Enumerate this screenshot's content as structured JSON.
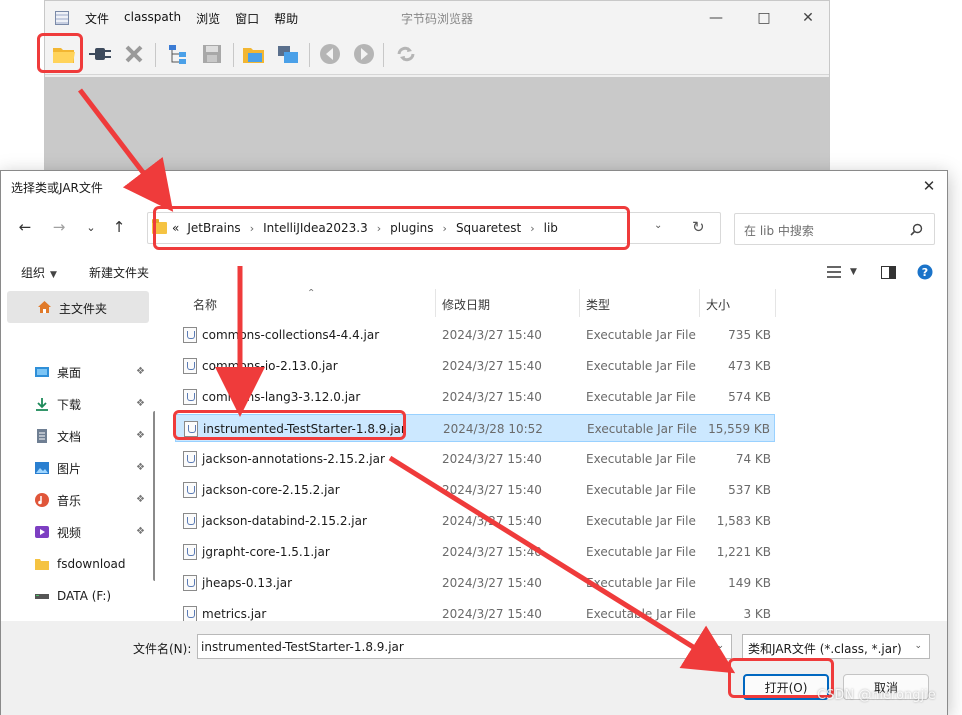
{
  "bg_app": {
    "menu": [
      "文件",
      "classpath",
      "浏览",
      "窗口",
      "帮助"
    ],
    "title": "字节码浏览器"
  },
  "dialog": {
    "title": "选择类或JAR文件",
    "breadcrumb_prefix": "«",
    "breadcrumb": [
      "JetBrains",
      "IntelliJIdea2023.3",
      "plugins",
      "Squaretest",
      "lib"
    ],
    "search_placeholder": "在 lib 中搜索",
    "commands": {
      "organize": "组织",
      "new_folder": "新建文件夹"
    },
    "sidebar": {
      "home": "主文件夹",
      "items": [
        {
          "label": "桌面",
          "icon": "desktop-icon",
          "pinned": true
        },
        {
          "label": "下载",
          "icon": "download-icon",
          "pinned": true
        },
        {
          "label": "文档",
          "icon": "document-icon",
          "pinned": true
        },
        {
          "label": "图片",
          "icon": "picture-icon",
          "pinned": true
        },
        {
          "label": "音乐",
          "icon": "music-icon",
          "pinned": true
        },
        {
          "label": "视频",
          "icon": "video-icon",
          "pinned": true
        },
        {
          "label": "fsdownload",
          "icon": "folder-icon",
          "pinned": false
        },
        {
          "label": "DATA (F:)",
          "icon": "drive-icon",
          "pinned": false
        }
      ]
    },
    "columns": {
      "name": "名称",
      "date": "修改日期",
      "type": "类型",
      "size": "大小"
    },
    "files": [
      {
        "name": "commons-collections4-4.4.jar",
        "date": "2024/3/27 15:40",
        "type": "Executable Jar File",
        "size": "735 KB"
      },
      {
        "name": "commons-io-2.13.0.jar",
        "date": "2024/3/27 15:40",
        "type": "Executable Jar File",
        "size": "473 KB"
      },
      {
        "name": "commons-lang3-3.12.0.jar",
        "date": "2024/3/27 15:40",
        "type": "Executable Jar File",
        "size": "574 KB"
      },
      {
        "name": "instrumented-TestStarter-1.8.9.jar",
        "date": "2024/3/28 10:52",
        "type": "Executable Jar File",
        "size": "15,559 KB",
        "selected": true
      },
      {
        "name": "jackson-annotations-2.15.2.jar",
        "date": "2024/3/27 15:40",
        "type": "Executable Jar File",
        "size": "74 KB"
      },
      {
        "name": "jackson-core-2.15.2.jar",
        "date": "2024/3/27 15:40",
        "type": "Executable Jar File",
        "size": "537 KB"
      },
      {
        "name": "jackson-databind-2.15.2.jar",
        "date": "2024/3/27 15:40",
        "type": "Executable Jar File",
        "size": "1,583 KB"
      },
      {
        "name": "jgrapht-core-1.5.1.jar",
        "date": "2024/3/27 15:40",
        "type": "Executable Jar File",
        "size": "1,221 KB"
      },
      {
        "name": "jheaps-0.13.jar",
        "date": "2024/3/27 15:40",
        "type": "Executable Jar File",
        "size": "149 KB"
      },
      {
        "name": "metrics.jar",
        "date": "2024/3/27 15:40",
        "type": "Executable Jar File",
        "size": "3 KB"
      }
    ],
    "filename_label": "文件名(N):",
    "filename_value": "instrumented-TestStarter-1.8.9.jar",
    "filetype_value": "类和JAR文件 (*.class, *.jar)",
    "open_button": "打开(O)",
    "cancel_button": "取消"
  },
  "annotation_color": "#ef3b3b",
  "watermark": "CSDN @nierongjie"
}
